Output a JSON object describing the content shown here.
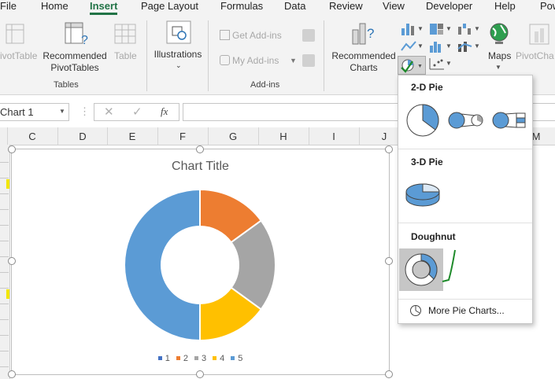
{
  "menu": {
    "tabs": [
      "File",
      "Home",
      "Insert",
      "Page Layout",
      "Formulas",
      "Data",
      "Review",
      "View",
      "Developer",
      "Help",
      "Pow"
    ],
    "active": "Insert"
  },
  "ribbon": {
    "pivot_table": "ivotTable",
    "recommended_pivot_1": "Recommended",
    "recommended_pivot_2": "PivotTables",
    "table": "Table",
    "tables_group": "Tables",
    "illustrations": "Illustrations",
    "get_addins": "Get Add-ins",
    "my_addins": "My Add-ins",
    "addins_group": "Add-ins",
    "recommended_charts_1": "Recommended",
    "recommended_charts_2": "Charts",
    "maps": "Maps",
    "pivot_chart": "PivotCha"
  },
  "formula_bar": {
    "name_box": "Chart 1",
    "fx": "fx"
  },
  "columns": [
    "C",
    "D",
    "E",
    "F",
    "G",
    "H",
    "I",
    "J",
    "M"
  ],
  "chart": {
    "title": "Chart Title",
    "legend": [
      "1",
      "2",
      "3",
      "4",
      "5"
    ]
  },
  "chart_data": {
    "type": "pie",
    "subtype": "doughnut",
    "title": "Chart Title",
    "categories": [
      "1",
      "2",
      "3",
      "4",
      "5"
    ],
    "values": [
      0,
      15,
      20,
      15,
      50
    ],
    "colors": [
      "#4472C4",
      "#ED7D31",
      "#A5A5A5",
      "#FFC000",
      "#5B9BD5"
    ],
    "legend_position": "bottom"
  },
  "dropdown": {
    "section_2d": "2-D Pie",
    "section_3d": "3-D Pie",
    "section_doughnut": "Doughnut",
    "more": "More Pie Charts..."
  },
  "colors": {
    "accent": "#217346",
    "pie_fill": "#5B9BD5",
    "selection": "#c6c6c6"
  }
}
